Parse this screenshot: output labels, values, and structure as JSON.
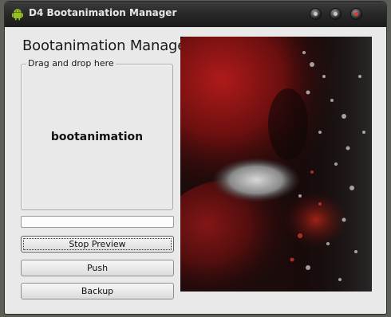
{
  "window": {
    "title": "D4 Bootanimation Manager"
  },
  "header": {
    "title": "Bootanimation Manager"
  },
  "drop_area": {
    "legend": "Drag and drop here",
    "content": "bootanimation"
  },
  "progress": {
    "value": 0
  },
  "buttons": {
    "stop_preview": "Stop Preview",
    "push": "Push",
    "backup": "Backup"
  },
  "colors": {
    "titlebar": "#262626",
    "window_bg": "#e9e9e9",
    "preview_red": "#8a1414",
    "android_green": "#97c024"
  },
  "icons": {
    "app": "android-icon",
    "window_controls": [
      "minimize-icon",
      "maximize-icon",
      "close-icon"
    ]
  }
}
